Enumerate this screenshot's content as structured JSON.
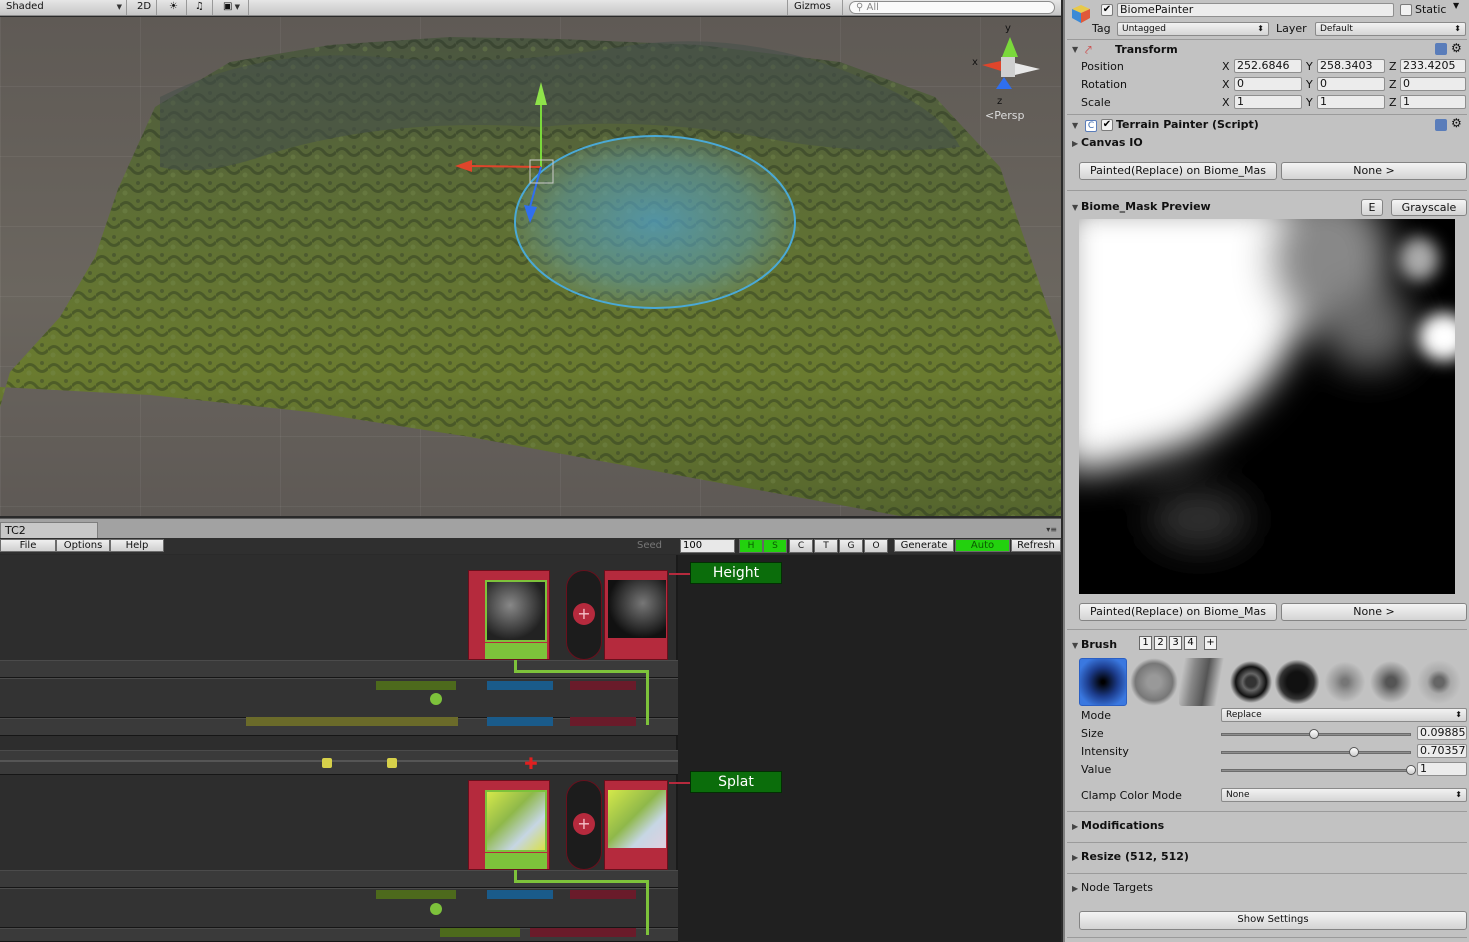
{
  "scene": {
    "shading_mode": "Shaded",
    "toggle_2d": "2D",
    "gizmos_label": "Gizmos",
    "search_placeholder": "All",
    "persp_label": "Persp",
    "gizmo_axes": {
      "x": "x",
      "y": "y",
      "z": "z"
    }
  },
  "tc2": {
    "tab_title": "TC2",
    "menu": [
      "File",
      "Options",
      "Help"
    ],
    "seed_label": "Seed",
    "seed_value": "100",
    "toggles": [
      {
        "label": "H",
        "on": true
      },
      {
        "label": "S",
        "on": true
      },
      {
        "label": "C",
        "on": false
      },
      {
        "label": "T",
        "on": false
      },
      {
        "label": "G",
        "on": false
      },
      {
        "label": "O",
        "on": false
      }
    ],
    "generate_label": "Generate",
    "auto_label": "Auto",
    "refresh_label": "Refresh",
    "height_label": "Height",
    "splat_label": "Splat"
  },
  "inspector": {
    "object_name": "BiomePainter",
    "static_label": "Static",
    "tag_label": "Tag",
    "tag_value": "Untagged",
    "layer_label": "Layer",
    "layer_value": "Default",
    "transform": {
      "title": "Transform",
      "position_label": "Position",
      "rotation_label": "Rotation",
      "scale_label": "Scale",
      "axis_x": "X",
      "axis_y": "Y",
      "axis_z": "Z",
      "position": [
        "252.6846",
        "258.3403",
        "233.4205"
      ],
      "rotation": [
        "0",
        "0",
        "0"
      ],
      "scale": [
        "1",
        "1",
        "1"
      ]
    },
    "script": {
      "title": "Terrain Painter (Script)",
      "canvas_io_label": "Canvas IO",
      "painted_button": "Painted(Replace) on Biome_Mas",
      "none_button": "None >",
      "preview_label": "Biome_Mask Preview",
      "e_button": "E",
      "grayscale_button": "Grayscale"
    },
    "brush": {
      "title": "Brush",
      "tabs": [
        "1",
        "2",
        "3",
        "4",
        "+"
      ],
      "mode_label": "Mode",
      "mode_value": "Replace",
      "size_label": "Size",
      "size_value": "0.09885",
      "size_fraction": 0.49,
      "intensity_label": "Intensity",
      "intensity_value": "0.70357",
      "intensity_fraction": 0.7,
      "value_label": "Value",
      "value_value": "1",
      "value_fraction": 1.0,
      "clamp_label": "Clamp Color Mode",
      "clamp_value": "None"
    },
    "sections": {
      "modifications": "Modifications",
      "resize": "Resize (512, 512)",
      "node_targets": "Node Targets"
    },
    "show_settings": "Show Settings"
  }
}
